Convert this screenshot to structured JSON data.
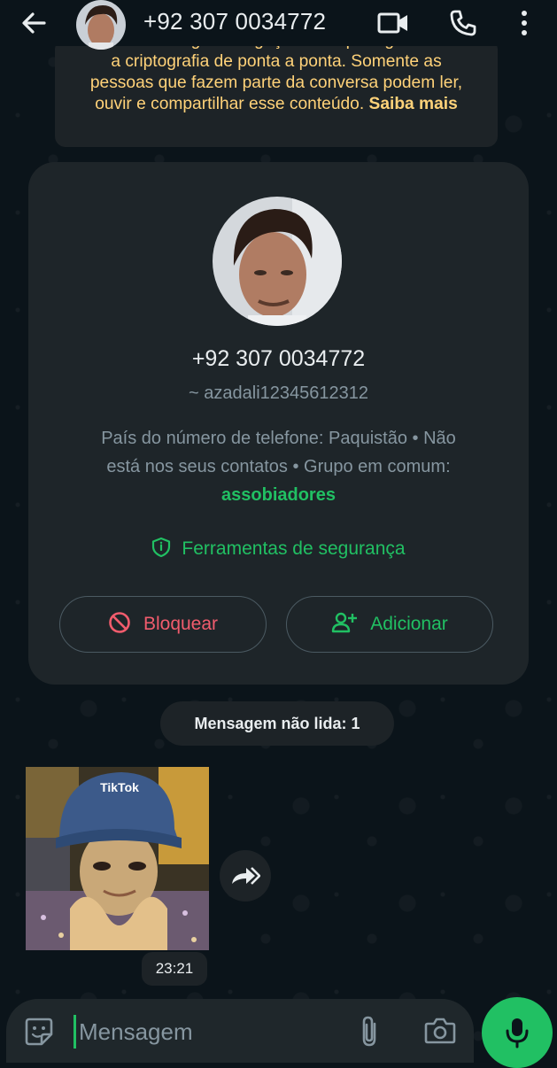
{
  "header": {
    "title": "+92 307 0034772",
    "icons": [
      "back-arrow-icon",
      "video-call-icon",
      "phone-call-icon",
      "more-vertical-icon"
    ]
  },
  "encryption_notice": {
    "line1": "🔒 As mensagens e ligações são protegidas com",
    "line2": "a criptografia de ponta a ponta. Somente as",
    "line3": "pessoas que fazem parte da conversa podem ler,",
    "line4": "ouvir e compartilhar esse conteúdo.",
    "learn_more": "Saiba mais"
  },
  "contact_card": {
    "phone": "+92 307 0034772",
    "username": "~ azadali12345612312",
    "info_line1": "País do número de telefone: Paquistão • Não",
    "info_line2": "está nos seus contatos • Grupo em comum:",
    "group_name": "assobiadores",
    "security_tools": "Ferramentas de segurança",
    "block_label": "Bloquear",
    "add_label": "Adicionar"
  },
  "unread_label": "Mensagem não lida: 1",
  "message": {
    "time": "23:21",
    "image_text": "TikTok"
  },
  "input": {
    "placeholder": "Mensagem"
  },
  "colors": {
    "accent_green": "#21c063",
    "block_red": "#f15c6d",
    "notice_yellow": "#ffd279",
    "background": "#0b141a"
  }
}
